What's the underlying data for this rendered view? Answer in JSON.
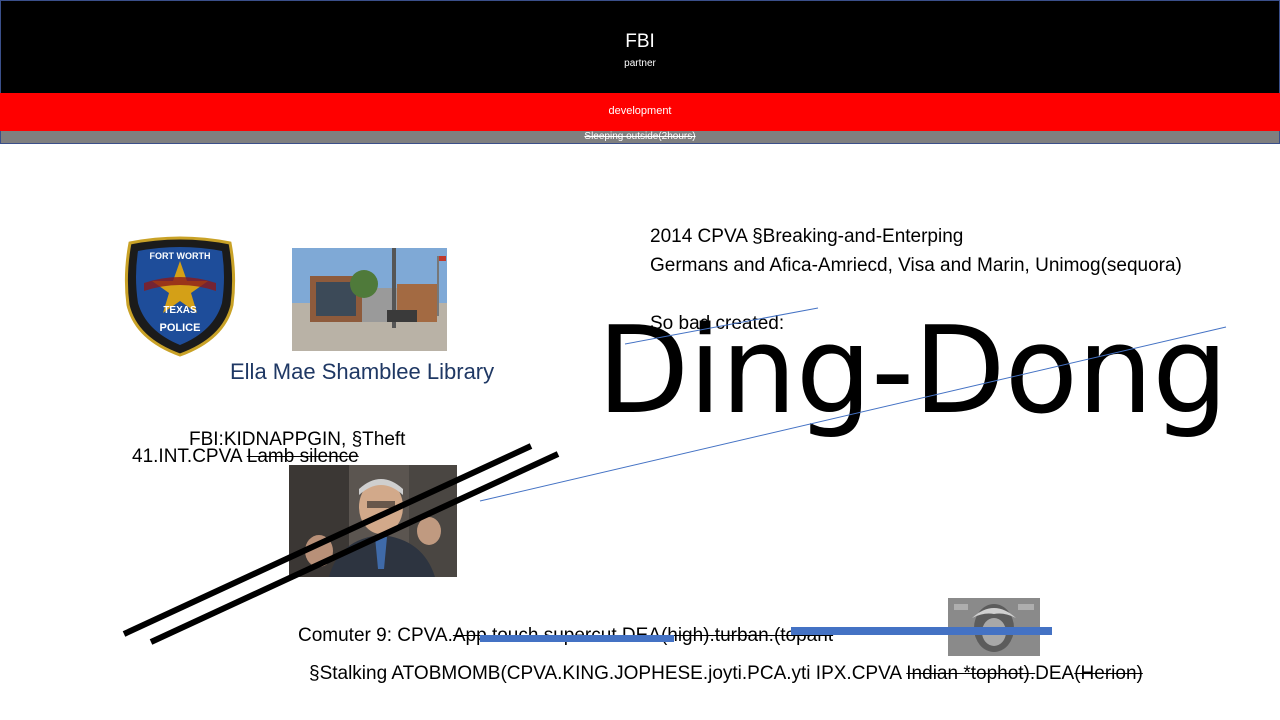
{
  "header": {
    "title": "FBI",
    "subtitle": "partner",
    "red_band": "development",
    "gray_band": "Sleeping outside(2hours)"
  },
  "images": {
    "badge_text": [
      "FORT WORTH",
      "TEXAS",
      "POLICE"
    ],
    "library_caption": "Ella Mae Shamblee Library"
  },
  "text": {
    "line1": "2014 CPVA §Breaking-and-Enterping",
    "line2": "Germans and Afica-Amriecd, Visa and Marin, Unimog(sequora)",
    "line3": "So bad created:",
    "big_word": "Ding-Dong",
    "fbi_line": "FBI:KIDNAPPGIN, §Theft",
    "int_prefix": "41.INT.CPVA ",
    "int_struck": "Lamb silence",
    "comuter_prefix": "Comuter 9: CPVA.",
    "comuter_struck": "App touch supercut DEA(high).turban.(topant",
    "stalking_prefix": "§Stalking ATOBMOMB(CPVA.KING.JOPHESE.joyti.PCA.yti IPX.CPVA ",
    "stalking_struck1": "Indian *tophot).",
    "stalking_mid": "DEA",
    "stalking_struck2": "(Herion)"
  },
  "colors": {
    "header_black": "#000000",
    "header_red": "#ff0000",
    "header_gray": "#7f7f7f",
    "caption_blue": "#1f3864",
    "connector_blue": "#4472c4"
  }
}
